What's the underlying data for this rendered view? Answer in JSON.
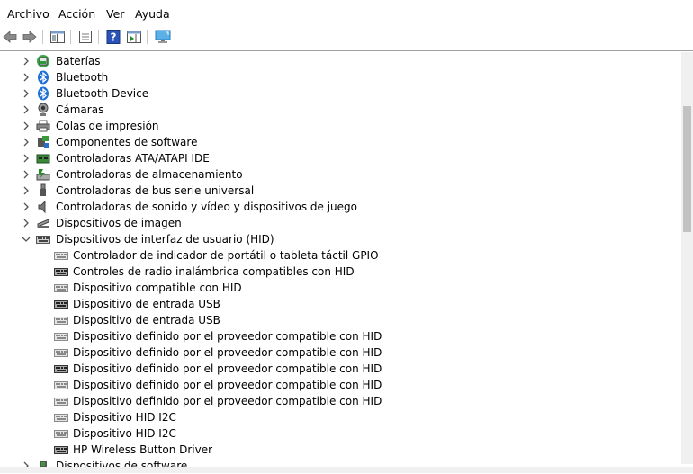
{
  "menu": [
    "Archivo",
    "Acción",
    "Ver",
    "Ayuda"
  ],
  "toolbar": {
    "buttons": [
      "back-arrow-icon",
      "forward-arrow-icon",
      "show-hide-tree-icon",
      "properties-icon",
      "help-icon",
      "action-pane-icon",
      "monitor-icon"
    ]
  },
  "tree": {
    "categories": [
      {
        "label": "Baterías",
        "icon": "battery-icon",
        "expanded": false
      },
      {
        "label": "Bluetooth",
        "icon": "bluetooth-icon",
        "expanded": false
      },
      {
        "label": "Bluetooth Device",
        "icon": "bluetooth-icon",
        "expanded": false
      },
      {
        "label": "Cámaras",
        "icon": "camera-icon",
        "expanded": false
      },
      {
        "label": "Colas de impresión",
        "icon": "printer-icon",
        "expanded": false
      },
      {
        "label": "Componentes de software",
        "icon": "software-component-icon",
        "expanded": false
      },
      {
        "label": "Controladoras ATA/ATAPI IDE",
        "icon": "ide-controller-icon",
        "expanded": false
      },
      {
        "label": "Controladoras de almacenamiento",
        "icon": "storage-controller-icon",
        "expanded": false
      },
      {
        "label": "Controladoras de bus serie universal",
        "icon": "usb-icon",
        "expanded": false
      },
      {
        "label": "Controladoras de sonido y vídeo y dispositivos de juego",
        "icon": "speaker-icon",
        "expanded": false
      },
      {
        "label": "Dispositivos de imagen",
        "icon": "scanner-icon",
        "expanded": false
      },
      {
        "label": "Dispositivos de interfaz de usuario (HID)",
        "icon": "keyboard-icon",
        "expanded": true
      }
    ],
    "hid_children": [
      "Controlador de indicador de portátil o tableta táctil GPIO",
      "Controles de radio inalámbrica compatibles con HID",
      "Dispositivo compatible con HID",
      "Dispositivo de entrada USB",
      "Dispositivo de entrada USB",
      "Dispositivo definido por el proveedor compatible con HID",
      "Dispositivo definido por el proveedor compatible con HID",
      "Dispositivo definido por el proveedor compatible con HID",
      "Dispositivo definido por el proveedor compatible con HID",
      "Dispositivo definido por el proveedor compatible con HID",
      "Dispositivo HID I2C",
      "Dispositivo HID I2C",
      "HP Wireless Button Driver"
    ],
    "hid_dark_icons": [
      false,
      true,
      false,
      true,
      false,
      false,
      false,
      true,
      false,
      false,
      false,
      false,
      true
    ],
    "after": [
      {
        "label": "Dispositivos de software",
        "icon": "software-device-icon",
        "expanded": false
      }
    ]
  },
  "colors": {
    "bluetooth": "#1e6fd9",
    "help": "#2b52b8",
    "monitor": "#1c7fc6",
    "arrow": "#6a6a6a"
  }
}
